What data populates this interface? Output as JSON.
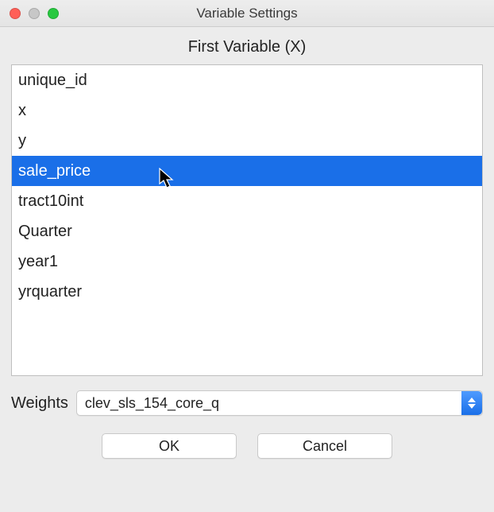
{
  "window": {
    "title": "Variable Settings"
  },
  "section": {
    "title": "First Variable (X)"
  },
  "variables": {
    "items": [
      {
        "label": "unique_id"
      },
      {
        "label": "x"
      },
      {
        "label": "y"
      },
      {
        "label": "sale_price"
      },
      {
        "label": "tract10int"
      },
      {
        "label": "Quarter"
      },
      {
        "label": "year1"
      },
      {
        "label": "yrquarter"
      }
    ],
    "selected_index": 3
  },
  "weights": {
    "label": "Weights",
    "selected": "clev_sls_154_core_q"
  },
  "buttons": {
    "ok_label": "OK",
    "cancel_label": "Cancel"
  }
}
